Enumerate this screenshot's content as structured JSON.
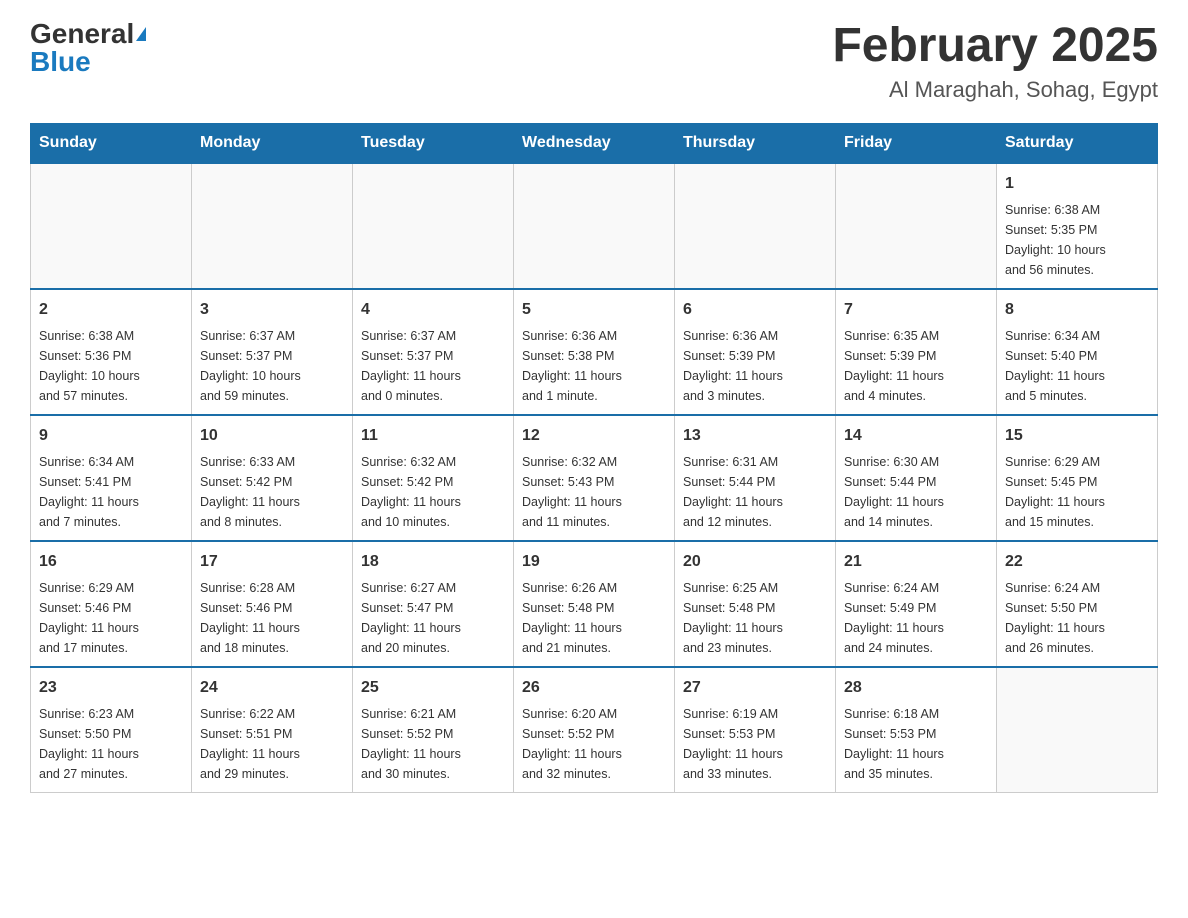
{
  "header": {
    "logo_general": "General",
    "logo_blue": "Blue",
    "month_title": "February 2025",
    "location": "Al Maraghah, Sohag, Egypt"
  },
  "weekdays": [
    "Sunday",
    "Monday",
    "Tuesday",
    "Wednesday",
    "Thursday",
    "Friday",
    "Saturday"
  ],
  "weeks": [
    [
      {
        "day": "",
        "info": ""
      },
      {
        "day": "",
        "info": ""
      },
      {
        "day": "",
        "info": ""
      },
      {
        "day": "",
        "info": ""
      },
      {
        "day": "",
        "info": ""
      },
      {
        "day": "",
        "info": ""
      },
      {
        "day": "1",
        "info": "Sunrise: 6:38 AM\nSunset: 5:35 PM\nDaylight: 10 hours\nand 56 minutes."
      }
    ],
    [
      {
        "day": "2",
        "info": "Sunrise: 6:38 AM\nSunset: 5:36 PM\nDaylight: 10 hours\nand 57 minutes."
      },
      {
        "day": "3",
        "info": "Sunrise: 6:37 AM\nSunset: 5:37 PM\nDaylight: 10 hours\nand 59 minutes."
      },
      {
        "day": "4",
        "info": "Sunrise: 6:37 AM\nSunset: 5:37 PM\nDaylight: 11 hours\nand 0 minutes."
      },
      {
        "day": "5",
        "info": "Sunrise: 6:36 AM\nSunset: 5:38 PM\nDaylight: 11 hours\nand 1 minute."
      },
      {
        "day": "6",
        "info": "Sunrise: 6:36 AM\nSunset: 5:39 PM\nDaylight: 11 hours\nand 3 minutes."
      },
      {
        "day": "7",
        "info": "Sunrise: 6:35 AM\nSunset: 5:39 PM\nDaylight: 11 hours\nand 4 minutes."
      },
      {
        "day": "8",
        "info": "Sunrise: 6:34 AM\nSunset: 5:40 PM\nDaylight: 11 hours\nand 5 minutes."
      }
    ],
    [
      {
        "day": "9",
        "info": "Sunrise: 6:34 AM\nSunset: 5:41 PM\nDaylight: 11 hours\nand 7 minutes."
      },
      {
        "day": "10",
        "info": "Sunrise: 6:33 AM\nSunset: 5:42 PM\nDaylight: 11 hours\nand 8 minutes."
      },
      {
        "day": "11",
        "info": "Sunrise: 6:32 AM\nSunset: 5:42 PM\nDaylight: 11 hours\nand 10 minutes."
      },
      {
        "day": "12",
        "info": "Sunrise: 6:32 AM\nSunset: 5:43 PM\nDaylight: 11 hours\nand 11 minutes."
      },
      {
        "day": "13",
        "info": "Sunrise: 6:31 AM\nSunset: 5:44 PM\nDaylight: 11 hours\nand 12 minutes."
      },
      {
        "day": "14",
        "info": "Sunrise: 6:30 AM\nSunset: 5:44 PM\nDaylight: 11 hours\nand 14 minutes."
      },
      {
        "day": "15",
        "info": "Sunrise: 6:29 AM\nSunset: 5:45 PM\nDaylight: 11 hours\nand 15 minutes."
      }
    ],
    [
      {
        "day": "16",
        "info": "Sunrise: 6:29 AM\nSunset: 5:46 PM\nDaylight: 11 hours\nand 17 minutes."
      },
      {
        "day": "17",
        "info": "Sunrise: 6:28 AM\nSunset: 5:46 PM\nDaylight: 11 hours\nand 18 minutes."
      },
      {
        "day": "18",
        "info": "Sunrise: 6:27 AM\nSunset: 5:47 PM\nDaylight: 11 hours\nand 20 minutes."
      },
      {
        "day": "19",
        "info": "Sunrise: 6:26 AM\nSunset: 5:48 PM\nDaylight: 11 hours\nand 21 minutes."
      },
      {
        "day": "20",
        "info": "Sunrise: 6:25 AM\nSunset: 5:48 PM\nDaylight: 11 hours\nand 23 minutes."
      },
      {
        "day": "21",
        "info": "Sunrise: 6:24 AM\nSunset: 5:49 PM\nDaylight: 11 hours\nand 24 minutes."
      },
      {
        "day": "22",
        "info": "Sunrise: 6:24 AM\nSunset: 5:50 PM\nDaylight: 11 hours\nand 26 minutes."
      }
    ],
    [
      {
        "day": "23",
        "info": "Sunrise: 6:23 AM\nSunset: 5:50 PM\nDaylight: 11 hours\nand 27 minutes."
      },
      {
        "day": "24",
        "info": "Sunrise: 6:22 AM\nSunset: 5:51 PM\nDaylight: 11 hours\nand 29 minutes."
      },
      {
        "day": "25",
        "info": "Sunrise: 6:21 AM\nSunset: 5:52 PM\nDaylight: 11 hours\nand 30 minutes."
      },
      {
        "day": "26",
        "info": "Sunrise: 6:20 AM\nSunset: 5:52 PM\nDaylight: 11 hours\nand 32 minutes."
      },
      {
        "day": "27",
        "info": "Sunrise: 6:19 AM\nSunset: 5:53 PM\nDaylight: 11 hours\nand 33 minutes."
      },
      {
        "day": "28",
        "info": "Sunrise: 6:18 AM\nSunset: 5:53 PM\nDaylight: 11 hours\nand 35 minutes."
      },
      {
        "day": "",
        "info": ""
      }
    ]
  ]
}
